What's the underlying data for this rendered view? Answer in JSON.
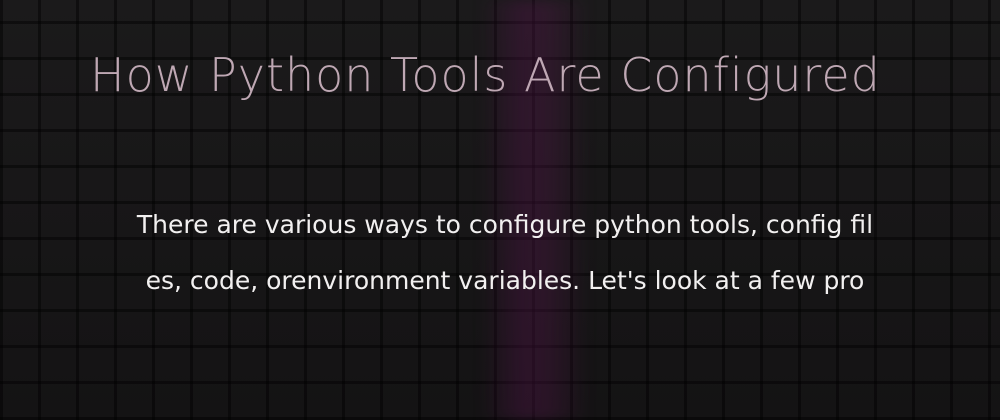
{
  "title": "How Python Tools Are Configured",
  "description": {
    "line1": "There are various ways to configure python tools, config fil",
    "line2": "es, code, orenvironment variables.  Let's look at a few pro"
  },
  "colors": {
    "background": "#171617",
    "title": "#bfa8b4",
    "text": "#f2f0f0",
    "accent_streak": "#6e195f"
  }
}
